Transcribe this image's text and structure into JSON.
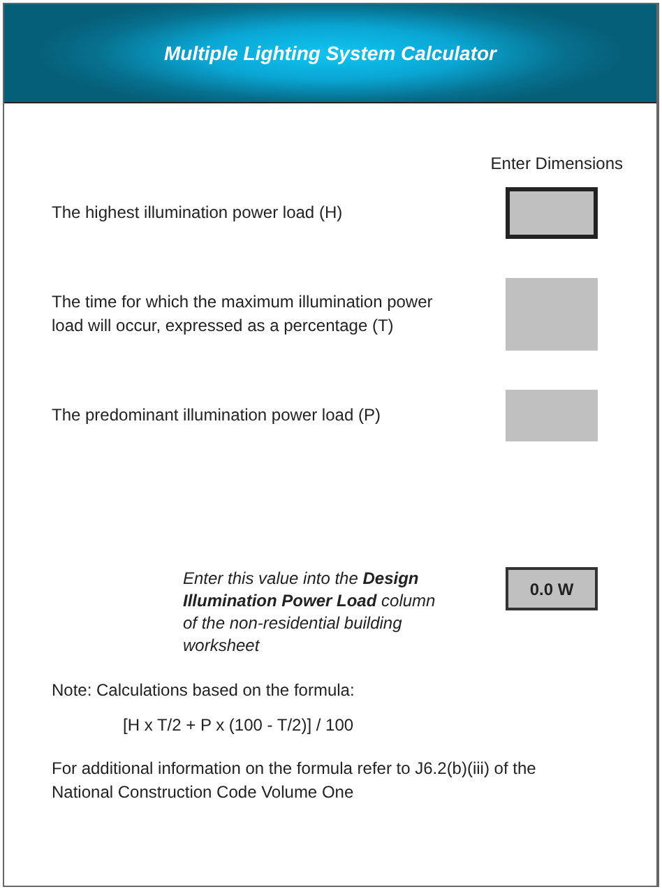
{
  "header": {
    "title": "Multiple Lighting System Calculator"
  },
  "column_heading": "Enter Dimensions",
  "inputs": [
    {
      "kind": "short",
      "label": "The highest illumination power load (H)",
      "selected": true
    },
    {
      "kind": "tall",
      "label": "The time for which the maximum illumination power load will occur, expressed as a percentage (T)",
      "selected": false
    },
    {
      "kind": "short",
      "label": "The predominant illumination power load (P)",
      "selected": false
    }
  ],
  "result": {
    "instruction": "Enter this value into the **Design Illumination Power Load** column of the non-residential building worksheet",
    "value": "0.0 W"
  },
  "notes": [
    {
      "kind": "text",
      "text": "Note: Calculations based on the formula:"
    },
    {
      "kind": "formula",
      "text": "[H x T/2 + P x (100 - T/2)] / 100"
    },
    {
      "kind": "text",
      "text": "For additional information on the formula refer to J6.2(b)(iii) of the National Construction Code Volume One"
    }
  ]
}
